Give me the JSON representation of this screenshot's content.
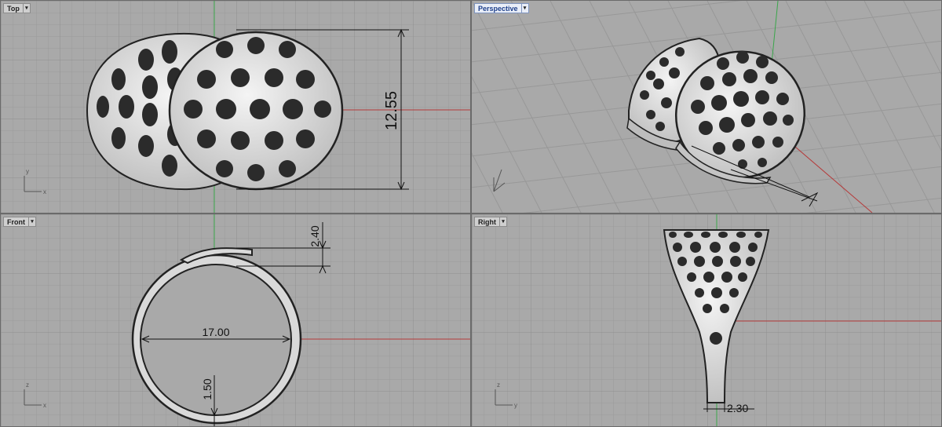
{
  "viewports": [
    {
      "name": "Top",
      "menu_icon": "viewport-menu-arrow-icon"
    },
    {
      "name": "Perspective",
      "menu_icon": "viewport-menu-arrow-icon"
    },
    {
      "name": "Front",
      "menu_icon": "viewport-menu-arrow-icon"
    },
    {
      "name": "Right",
      "menu_icon": "viewport-menu-arrow-icon"
    }
  ],
  "dimensions": {
    "top_height": "12.55",
    "front_top": "2.40",
    "front_inner_diameter": "17.00",
    "front_band": "1.50",
    "right_width": "2.30"
  },
  "axis_labels": {
    "x": "x",
    "y": "y",
    "z": "z"
  },
  "colors": {
    "grid_bg": "#a9a9a9",
    "x_axis": "#b53a3a",
    "y_axis": "#3aa64a",
    "active_title": "#1d3f8a"
  }
}
